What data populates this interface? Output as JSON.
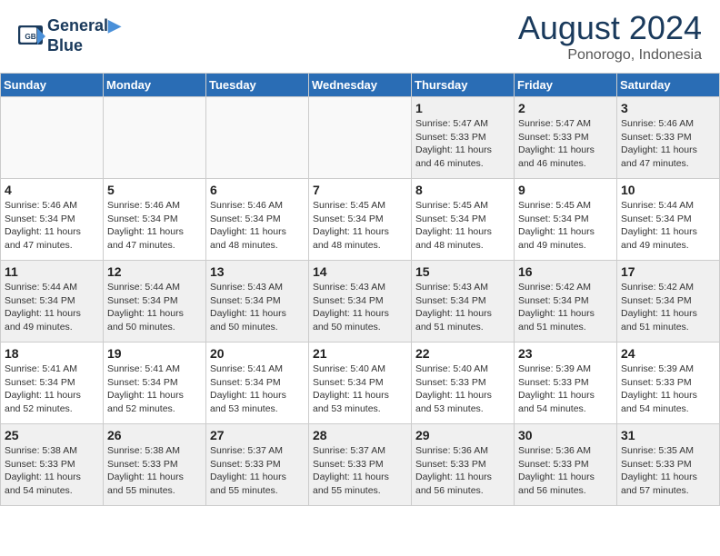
{
  "header": {
    "logo_line1": "General",
    "logo_line2": "Blue",
    "month_year": "August 2024",
    "location": "Ponorogo, Indonesia"
  },
  "weekdays": [
    "Sunday",
    "Monday",
    "Tuesday",
    "Wednesday",
    "Thursday",
    "Friday",
    "Saturday"
  ],
  "weeks": [
    [
      {
        "day": "",
        "info": ""
      },
      {
        "day": "",
        "info": ""
      },
      {
        "day": "",
        "info": ""
      },
      {
        "day": "",
        "info": ""
      },
      {
        "day": "1",
        "info": "Sunrise: 5:47 AM\nSunset: 5:33 PM\nDaylight: 11 hours\nand 46 minutes."
      },
      {
        "day": "2",
        "info": "Sunrise: 5:47 AM\nSunset: 5:33 PM\nDaylight: 11 hours\nand 46 minutes."
      },
      {
        "day": "3",
        "info": "Sunrise: 5:46 AM\nSunset: 5:33 PM\nDaylight: 11 hours\nand 47 minutes."
      }
    ],
    [
      {
        "day": "4",
        "info": "Sunrise: 5:46 AM\nSunset: 5:34 PM\nDaylight: 11 hours\nand 47 minutes."
      },
      {
        "day": "5",
        "info": "Sunrise: 5:46 AM\nSunset: 5:34 PM\nDaylight: 11 hours\nand 47 minutes."
      },
      {
        "day": "6",
        "info": "Sunrise: 5:46 AM\nSunset: 5:34 PM\nDaylight: 11 hours\nand 48 minutes."
      },
      {
        "day": "7",
        "info": "Sunrise: 5:45 AM\nSunset: 5:34 PM\nDaylight: 11 hours\nand 48 minutes."
      },
      {
        "day": "8",
        "info": "Sunrise: 5:45 AM\nSunset: 5:34 PM\nDaylight: 11 hours\nand 48 minutes."
      },
      {
        "day": "9",
        "info": "Sunrise: 5:45 AM\nSunset: 5:34 PM\nDaylight: 11 hours\nand 49 minutes."
      },
      {
        "day": "10",
        "info": "Sunrise: 5:44 AM\nSunset: 5:34 PM\nDaylight: 11 hours\nand 49 minutes."
      }
    ],
    [
      {
        "day": "11",
        "info": "Sunrise: 5:44 AM\nSunset: 5:34 PM\nDaylight: 11 hours\nand 49 minutes."
      },
      {
        "day": "12",
        "info": "Sunrise: 5:44 AM\nSunset: 5:34 PM\nDaylight: 11 hours\nand 50 minutes."
      },
      {
        "day": "13",
        "info": "Sunrise: 5:43 AM\nSunset: 5:34 PM\nDaylight: 11 hours\nand 50 minutes."
      },
      {
        "day": "14",
        "info": "Sunrise: 5:43 AM\nSunset: 5:34 PM\nDaylight: 11 hours\nand 50 minutes."
      },
      {
        "day": "15",
        "info": "Sunrise: 5:43 AM\nSunset: 5:34 PM\nDaylight: 11 hours\nand 51 minutes."
      },
      {
        "day": "16",
        "info": "Sunrise: 5:42 AM\nSunset: 5:34 PM\nDaylight: 11 hours\nand 51 minutes."
      },
      {
        "day": "17",
        "info": "Sunrise: 5:42 AM\nSunset: 5:34 PM\nDaylight: 11 hours\nand 51 minutes."
      }
    ],
    [
      {
        "day": "18",
        "info": "Sunrise: 5:41 AM\nSunset: 5:34 PM\nDaylight: 11 hours\nand 52 minutes."
      },
      {
        "day": "19",
        "info": "Sunrise: 5:41 AM\nSunset: 5:34 PM\nDaylight: 11 hours\nand 52 minutes."
      },
      {
        "day": "20",
        "info": "Sunrise: 5:41 AM\nSunset: 5:34 PM\nDaylight: 11 hours\nand 53 minutes."
      },
      {
        "day": "21",
        "info": "Sunrise: 5:40 AM\nSunset: 5:34 PM\nDaylight: 11 hours\nand 53 minutes."
      },
      {
        "day": "22",
        "info": "Sunrise: 5:40 AM\nSunset: 5:33 PM\nDaylight: 11 hours\nand 53 minutes."
      },
      {
        "day": "23",
        "info": "Sunrise: 5:39 AM\nSunset: 5:33 PM\nDaylight: 11 hours\nand 54 minutes."
      },
      {
        "day": "24",
        "info": "Sunrise: 5:39 AM\nSunset: 5:33 PM\nDaylight: 11 hours\nand 54 minutes."
      }
    ],
    [
      {
        "day": "25",
        "info": "Sunrise: 5:38 AM\nSunset: 5:33 PM\nDaylight: 11 hours\nand 54 minutes."
      },
      {
        "day": "26",
        "info": "Sunrise: 5:38 AM\nSunset: 5:33 PM\nDaylight: 11 hours\nand 55 minutes."
      },
      {
        "day": "27",
        "info": "Sunrise: 5:37 AM\nSunset: 5:33 PM\nDaylight: 11 hours\nand 55 minutes."
      },
      {
        "day": "28",
        "info": "Sunrise: 5:37 AM\nSunset: 5:33 PM\nDaylight: 11 hours\nand 55 minutes."
      },
      {
        "day": "29",
        "info": "Sunrise: 5:36 AM\nSunset: 5:33 PM\nDaylight: 11 hours\nand 56 minutes."
      },
      {
        "day": "30",
        "info": "Sunrise: 5:36 AM\nSunset: 5:33 PM\nDaylight: 11 hours\nand 56 minutes."
      },
      {
        "day": "31",
        "info": "Sunrise: 5:35 AM\nSunset: 5:33 PM\nDaylight: 11 hours\nand 57 minutes."
      }
    ]
  ]
}
